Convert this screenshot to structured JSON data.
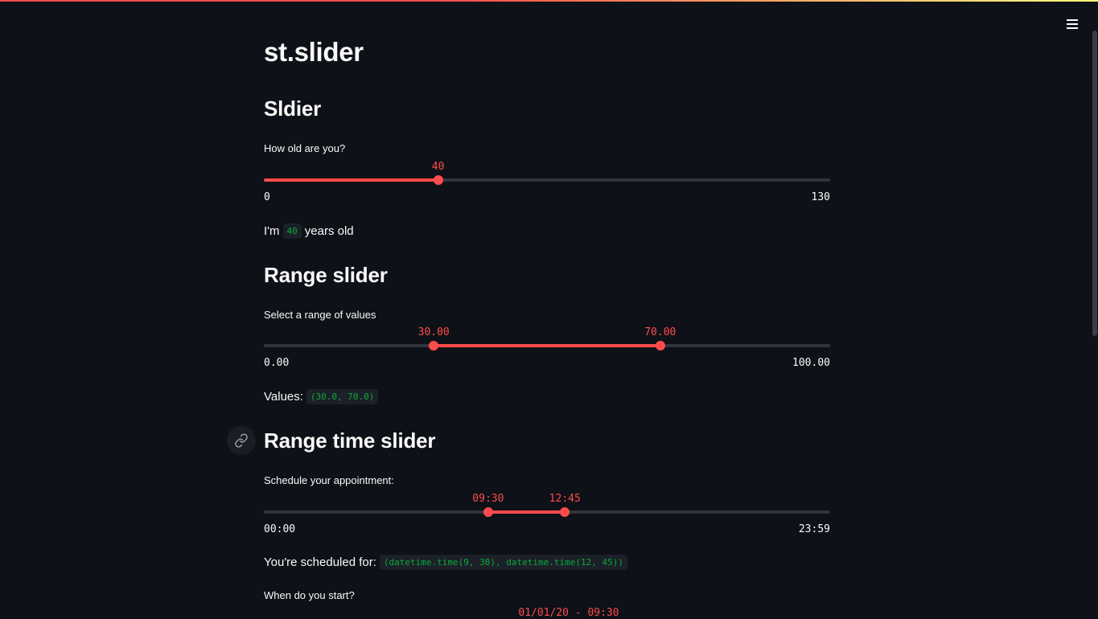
{
  "page": {
    "title": "st.slider"
  },
  "section_slider": {
    "heading": "Sldier",
    "label": "How old are you?",
    "value": 40,
    "value_text": "40",
    "min": 0,
    "max": 130,
    "min_text": "0",
    "max_text": "130",
    "result_prefix": "I'm",
    "result_code": "40",
    "result_suffix": "years old"
  },
  "section_range": {
    "heading": "Range slider",
    "label": "Select a range of values",
    "low": 30,
    "high": 70,
    "low_text": "30.00",
    "high_text": "70.00",
    "min": 0,
    "max": 100,
    "min_text": "0.00",
    "max_text": "100.00",
    "result_prefix": "Values:",
    "result_code": "(30.0, 70.0)"
  },
  "section_time": {
    "heading": "Range time slider",
    "label": "Schedule your appointment:",
    "low_minutes": 570,
    "high_minutes": 765,
    "low_text": "09:30",
    "high_text": "12:45",
    "min_minutes": 0,
    "max_minutes": 1439,
    "min_text": "00:00",
    "max_text": "23:59",
    "result_prefix": "You're scheduled for:",
    "result_code": "(datetime.time(9, 30), datetime.time(12, 45))"
  },
  "section_datetime": {
    "label": "When do you start?",
    "value_text": "01/01/20 - 09:30"
  },
  "colors": {
    "accent": "#ff4b4b",
    "code_text": "#09ab3b",
    "background": "#0e1117",
    "track": "#31333f"
  },
  "icons": {
    "menu": "hamburger-menu-icon",
    "anchor": "link-icon"
  }
}
